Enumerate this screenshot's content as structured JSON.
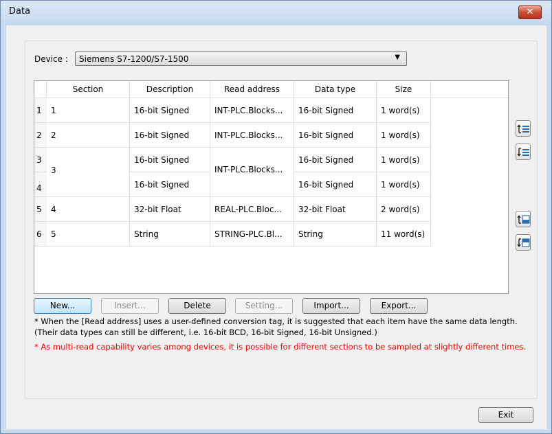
{
  "window": {
    "title": "Data",
    "close_symbol": "✕"
  },
  "device": {
    "label": "Device :",
    "value": "Siemens S7-1200/S7-1500"
  },
  "table": {
    "columns": [
      "Section",
      "Description",
      "Read address",
      "Data type",
      "Size"
    ],
    "rows": [
      {
        "num": "1",
        "section": "1",
        "description": "16-bit Signed",
        "read_address": "INT-PLC.Blocks...",
        "data_type": "16-bit Signed",
        "size": "1 word(s)"
      },
      {
        "num": "2",
        "section": "2",
        "description": "16-bit Signed",
        "read_address": "INT-PLC.Blocks...",
        "data_type": "16-bit Signed",
        "size": "1 word(s)"
      },
      {
        "num": "3",
        "section": "3",
        "description": "16-bit Signed",
        "read_address": "INT-PLC.Blocks...",
        "data_type": "16-bit Signed",
        "size": "1 word(s)"
      },
      {
        "num": "4",
        "section": "",
        "description": "16-bit Signed",
        "read_address": "",
        "data_type": "16-bit Signed",
        "size": "1 word(s)"
      },
      {
        "num": "5",
        "section": "4",
        "description": "32-bit Float",
        "read_address": "REAL-PLC.Bloc...",
        "data_type": "32-bit Float",
        "size": "2 word(s)"
      },
      {
        "num": "6",
        "section": "5",
        "description": "String",
        "read_address": "STRING-PLC.Bl...",
        "data_type": "String",
        "size": "11 word(s)"
      }
    ]
  },
  "side_buttons": {
    "move_up": "move-up-icon",
    "move_down": "move-down-icon",
    "move_section_up": "move-section-up-icon",
    "move_section_down": "move-section-down-icon"
  },
  "buttons": {
    "new": "New...",
    "insert": "Insert...",
    "delete": "Delete",
    "setting": "Setting...",
    "import": "Import...",
    "export": "Export...",
    "exit": "Exit"
  },
  "notes": {
    "note1": "* When the [Read address] uses a user-defined conversion tag, it is suggested that each item have the same data length. (Their data types can still be different, i.e. 16-bit BCD, 16-bit Signed, 16-bit Unsigned.)",
    "note2": "* As multi-read capability varies among devices, it is possible for different sections to be sampled at slightly different times."
  },
  "colors": {
    "warning_text": "#ff0000",
    "title_bar": "#c5d8ee",
    "close_button": "#c9503b"
  }
}
